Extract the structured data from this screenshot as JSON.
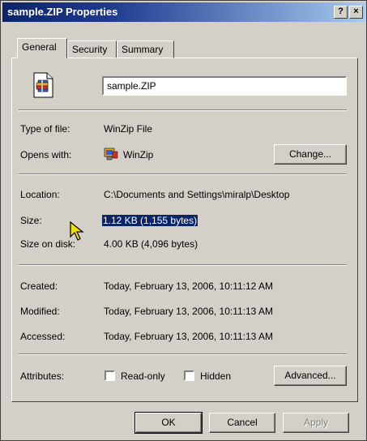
{
  "window": {
    "title": "sample.ZIP Properties",
    "help_button": "?",
    "close_button": "×"
  },
  "tabs": [
    {
      "label": "General",
      "active": true
    },
    {
      "label": "Security",
      "active": false
    },
    {
      "label": "Summary",
      "active": false
    }
  ],
  "general": {
    "file_name": "sample.ZIP",
    "file_icon": "zip-file-icon",
    "type_label": "Type of file:",
    "type_value": "WinZip File",
    "opens_with_label": "Opens with:",
    "opens_with_value": "WinZip",
    "opens_with_icon": "winzip-icon",
    "change_button": "Change...",
    "location_label": "Location:",
    "location_value": "C:\\Documents and Settings\\miralp\\Desktop",
    "size_label": "Size:",
    "size_value": "1.12 KB (1,155 bytes)",
    "size_on_disk_label": "Size on disk:",
    "size_on_disk_value": "4.00 KB (4,096 bytes)",
    "created_label": "Created:",
    "created_value": "Today, February 13, 2006, 10:11:12 AM",
    "modified_label": "Modified:",
    "modified_value": "Today, February 13, 2006, 10:11:13 AM",
    "accessed_label": "Accessed:",
    "accessed_value": "Today, February 13, 2006, 10:11:13 AM",
    "attributes_label": "Attributes:",
    "readonly_label": "Read-only",
    "readonly_checked": false,
    "hidden_label": "Hidden",
    "hidden_checked": false,
    "advanced_button": "Advanced..."
  },
  "footer": {
    "ok_button": "OK",
    "cancel_button": "Cancel",
    "apply_button": "Apply"
  },
  "colors": {
    "titlebar_start": "#0a246a",
    "titlebar_end": "#a6caf0",
    "face": "#d4d0c8",
    "selection": "#0a246a"
  }
}
